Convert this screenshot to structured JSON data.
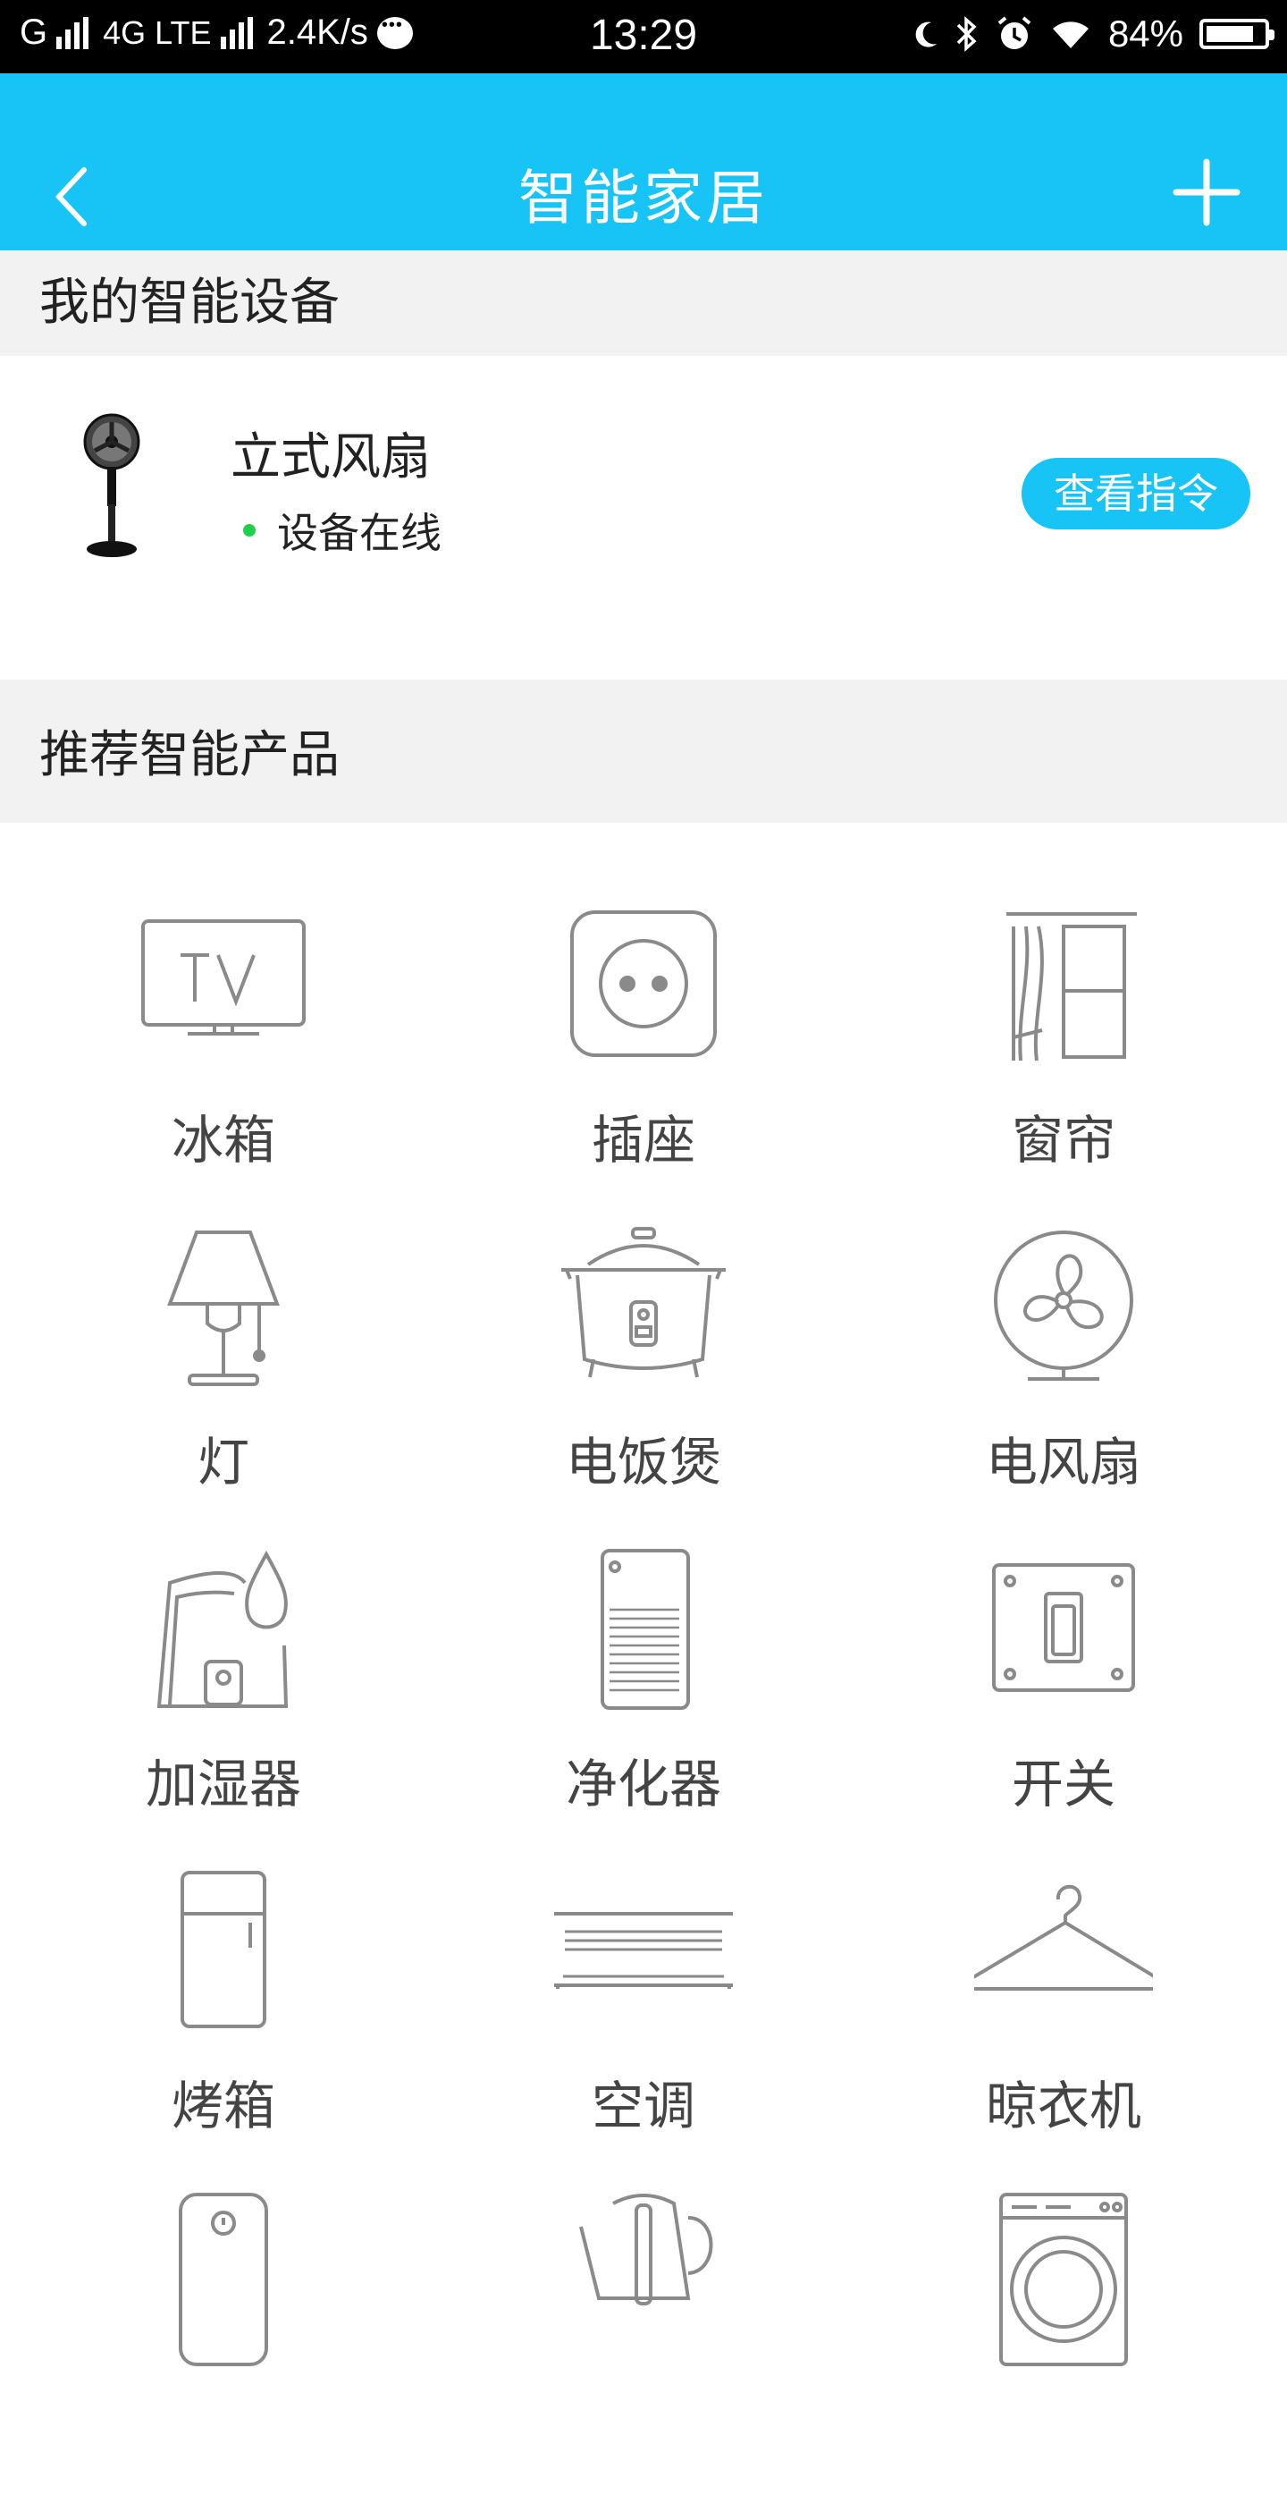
{
  "status_bar": {
    "carrier": "G",
    "network": "4G LTE",
    "speed": "2.4K/s",
    "time": "13:29",
    "battery": "84%",
    "battery_level": 0.84,
    "icons": [
      "signal-icon",
      "chat-icon",
      "moon-icon",
      "bluetooth-icon",
      "alarm-icon",
      "wifi-icon",
      "battery-icon"
    ]
  },
  "header": {
    "title": "智能家居",
    "back_icon": "back-icon",
    "add_icon": "plus-icon",
    "color": "#17c4f5"
  },
  "my_devices": {
    "section_title": "我的智能设备",
    "items": [
      {
        "name": "立式风扇",
        "status": "设备在线",
        "status_color": "#21d04a",
        "button": "查看指令"
      }
    ]
  },
  "recommended": {
    "section_title": "推荐智能产品",
    "products": [
      {
        "label": "冰箱",
        "icon": "tv-icon"
      },
      {
        "label": "插座",
        "icon": "socket-icon"
      },
      {
        "label": "窗帘",
        "icon": "curtain-icon"
      },
      {
        "label": "灯",
        "icon": "lamp-icon"
      },
      {
        "label": "电饭煲",
        "icon": "rice-cooker-icon"
      },
      {
        "label": "电风扇",
        "icon": "fan-icon"
      },
      {
        "label": "加湿器",
        "icon": "humidifier-icon"
      },
      {
        "label": "净化器",
        "icon": "purifier-icon"
      },
      {
        "label": "开关",
        "icon": "switch-icon"
      },
      {
        "label": "烤箱",
        "icon": "fridge-icon"
      },
      {
        "label": "空调",
        "icon": "air-conditioner-icon"
      },
      {
        "label": "晾衣机",
        "icon": "hanger-icon"
      },
      {
        "label": "",
        "icon": "heater-icon"
      },
      {
        "label": "",
        "icon": "kettle-icon"
      },
      {
        "label": "",
        "icon": "washing-machine-icon"
      }
    ]
  }
}
